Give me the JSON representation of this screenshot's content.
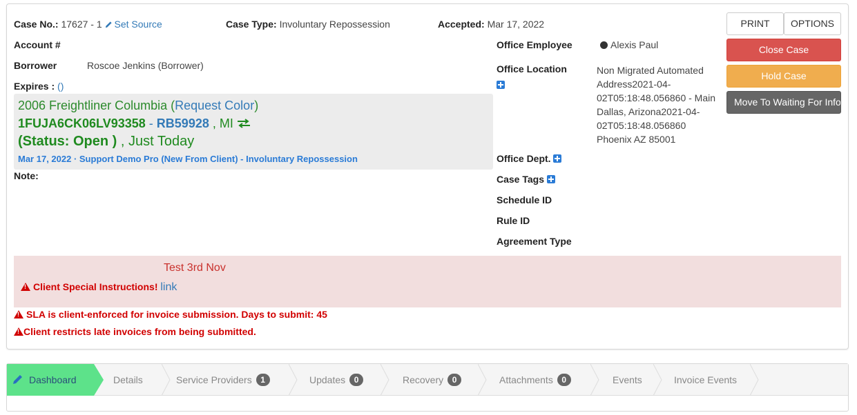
{
  "header": {
    "case_no_label": "Case No.:",
    "case_no_value": "17627 - 1",
    "set_source": "Set Source",
    "case_type_label": "Case Type:",
    "case_type_value": "Involuntary Repossession",
    "accepted_label": "Accepted:",
    "accepted_value": "Mar 17, 2022"
  },
  "left_fields": {
    "account_label": "Account #",
    "borrower_label": "Borrower",
    "borrower_value": "Roscoe Jenkins (Borrower)",
    "expires_label": "Expires :",
    "expires_value": "()"
  },
  "vehicle": {
    "title": "2006 Freightliner Columbia",
    "request_color": "Request Color",
    "vin": "1FUJA6CK06LV93358",
    "plate": "RB59928",
    "state": ", MI",
    "status": "(Status: Open )",
    "status_suffix": ", Just Today",
    "meta": "Mar 17, 2022 · Support Demo Pro (New From Client) - Involuntary Repossession"
  },
  "note_label": "Note:",
  "right_fields": {
    "office_employee_label": "Office Employee",
    "office_employee_value": "Alexis Paul",
    "office_location_label": "Office Location",
    "office_location_value": "Non Migrated Automated Address2021-04-02T05:18:48.056860 - Main Dallas, Arizona2021-04-02T05:18:48.056860 Phoenix AZ 85001",
    "office_dept_label": "Office Dept.",
    "case_tags_label": "Case Tags",
    "schedule_id_label": "Schedule ID",
    "rule_id_label": "Rule ID",
    "agreement_type_label": "Agreement Type"
  },
  "actions": {
    "print": "PRINT",
    "options": "OPTIONS",
    "close_case": "Close Case",
    "hold_case": "Hold Case",
    "move_waiting": "Move To Waiting For Info"
  },
  "instructions": {
    "title": "Test 3rd Nov",
    "client_special": "Client Special Instructions!",
    "link": "link",
    "sla": "SLA is client-enforced for invoice submission. Days to submit: 45",
    "late": "Client restricts late invoices from being submitted."
  },
  "tabs": [
    {
      "label": "Dashboard"
    },
    {
      "label": "Details"
    },
    {
      "label": "Service Providers",
      "badge": "1"
    },
    {
      "label": "Updates",
      "badge": "0"
    },
    {
      "label": "Recovery",
      "badge": "0"
    },
    {
      "label": "Attachments",
      "badge": "0"
    },
    {
      "label": "Events"
    },
    {
      "label": "Invoice Events"
    }
  ],
  "colors": {
    "active_tab": "#5de28a",
    "close_case": "#d9534f",
    "hold_case": "#f0ad4e",
    "move_waiting": "#666666",
    "alert": "#d10000",
    "instructions_bg": "#f2dede"
  }
}
